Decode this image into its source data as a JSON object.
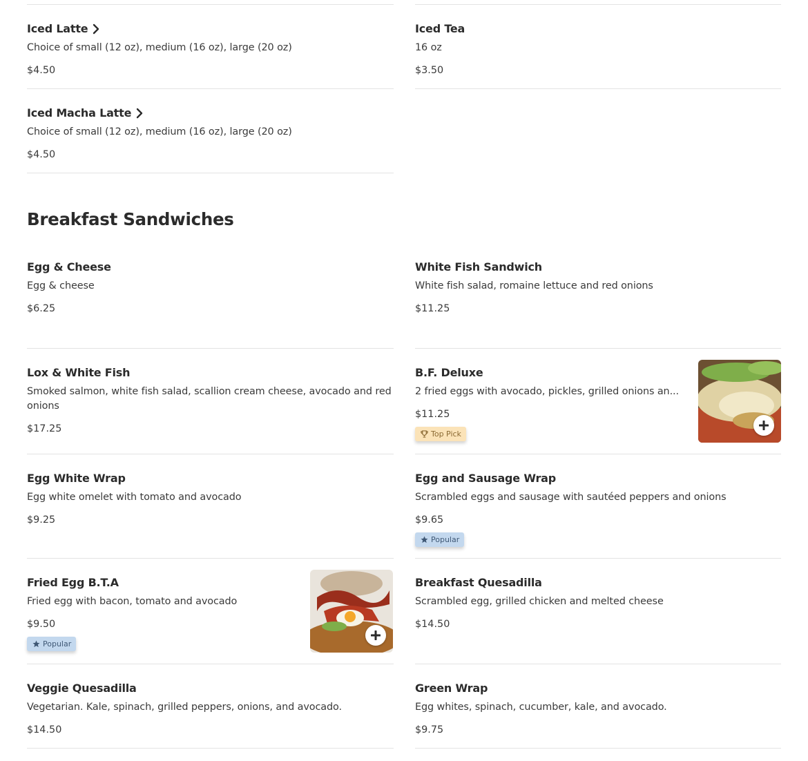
{
  "drinks": [
    {
      "name": "Iced Latte",
      "desc": "Choice of small (12 oz), medium (16 oz), large (20 oz)",
      "price": "$4.50"
    },
    {
      "name": "Iced Tea",
      "desc": "16 oz",
      "price": "$3.50"
    },
    {
      "name": "Iced Macha Latte",
      "desc": "Choice of small (12 oz), medium (16 oz), large (20 oz)",
      "price": "$4.50"
    }
  ],
  "section": {
    "title": "Breakfast Sandwiches"
  },
  "sandwiches": [
    {
      "name": "Egg & Cheese",
      "desc": "Egg & cheese",
      "price": "$6.25"
    },
    {
      "name": "White Fish Sandwich",
      "desc": "White fish salad, romaine lettuce and red onions",
      "price": "$11.25"
    },
    {
      "name": "Lox & White Fish",
      "desc": "Smoked salmon, white fish salad, scallion cream cheese, avocado and red onions",
      "price": "$17.25"
    },
    {
      "name": "B.F. Deluxe",
      "desc": "2 fried eggs with avocado, pickles, grilled onions an...",
      "price": "$11.25",
      "badge": "Top Pick"
    },
    {
      "name": "Egg White Wrap",
      "desc": "Egg white omelet with tomato and avocado",
      "price": "$9.25"
    },
    {
      "name": "Egg and Sausage Wrap",
      "desc": "Scrambled eggs and sausage with sautéed peppers and onions",
      "price": "$9.65",
      "badge": "Popular"
    },
    {
      "name": "Fried Egg B.T.A",
      "desc": "Fried egg with bacon, tomato and avocado",
      "price": "$9.50",
      "badge": "Popular"
    },
    {
      "name": "Breakfast Quesadilla",
      "desc": "Scrambled egg, grilled chicken and melted cheese",
      "price": "$14.50"
    },
    {
      "name": "Veggie Quesadilla",
      "desc": "Vegetarian. Kale, spinach, grilled peppers, onions, and avocado.",
      "price": "$14.50"
    },
    {
      "name": "Green Wrap",
      "desc": "Egg whites, spinach, cucumber, kale, and avocado.",
      "price": "$9.75"
    }
  ],
  "colors": {
    "top_pick_bg": "#fbe3b8",
    "popular_bg": "#c3d8ee",
    "divider": "#e3e3e3"
  },
  "icons": {
    "expand": "chevron-right-icon",
    "top_pick": "trophy-icon",
    "popular": "star-icon",
    "add": "plus-icon"
  }
}
